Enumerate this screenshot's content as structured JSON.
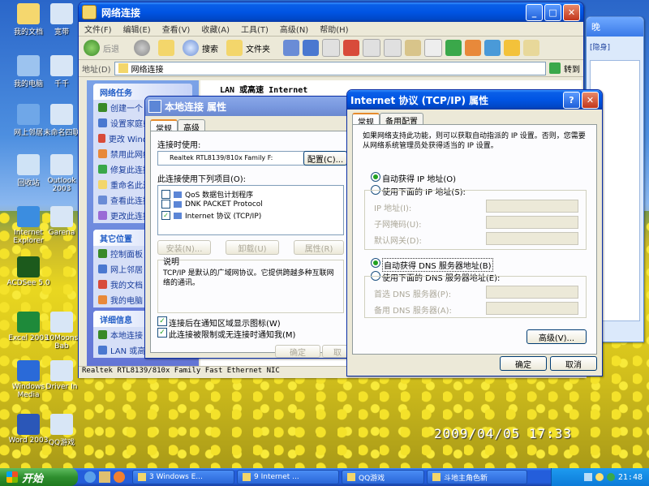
{
  "desktop": {
    "icons": [
      {
        "label": "我的文档",
        "color": "#f5d76e"
      },
      {
        "label": "我的电脑",
        "color": "#9cc3ef"
      },
      {
        "label": "网上邻居",
        "color": "#6fa7e8"
      },
      {
        "label": "回收站",
        "color": "#cfe3f6"
      },
      {
        "label": "Internet Explorer",
        "color": "#3b8de0"
      },
      {
        "label": "ACDSee 5.0",
        "color": "#1c5a1c"
      },
      {
        "label": "Excel 2003",
        "color": "#1e8a3a"
      },
      {
        "label": "Windows Media",
        "color": "#2a6ad8"
      },
      {
        "label": "Word 2003",
        "color": "#2b57b8"
      }
    ],
    "icons_col2": [
      {
        "label": "宽带"
      },
      {
        "label": "千千"
      },
      {
        "label": "未命名四联"
      },
      {
        "label": "Outlook 2003"
      },
      {
        "label": "Garena"
      },
      {
        "label": "10Moons Bab"
      },
      {
        "label": "Driver In"
      },
      {
        "label": "QQ游戏"
      }
    ],
    "photo_timestamp": "2009/04/05 17:33"
  },
  "explorer": {
    "title": "网络连接",
    "menu": [
      "文件(F)",
      "编辑(E)",
      "查看(V)",
      "收藏(A)",
      "工具(T)",
      "高级(N)",
      "帮助(H)"
    ],
    "toolbar": {
      "back": "后退",
      "search": "搜索",
      "folders": "文件夹"
    },
    "address_label": "地址(D)",
    "address_value": "网络连接",
    "go_label": "转到",
    "list_header": "LAN 或高速 Internet",
    "task_groups": [
      {
        "title": "网络任务",
        "items": [
          "创建一个",
          "设置家庭或小型网络",
          "更改 Windows 防火墙设置",
          "禁用此网络",
          "修复此连接",
          "重命名此连接",
          "查看此连接",
          "更改此连接"
        ]
      },
      {
        "title": "其它位置",
        "items": [
          "控制面板",
          "网上邻居",
          "我的文档",
          "我的电脑"
        ]
      },
      {
        "title": "详细信息",
        "items": [
          "本地连接",
          "LAN 或高速 I"
        ]
      }
    ],
    "status_bar": "Realtek RTL8139/810x Family Fast Ethernet NIC"
  },
  "local_props": {
    "title": "本地连接 属性",
    "tabs": [
      "常规",
      "高级"
    ],
    "connect_using_label": "连接时使用:",
    "adapter": "Realtek RTL8139/810x Family F:",
    "configure": "配置(C)...",
    "items_label": "此连接使用下列项目(O):",
    "items": [
      {
        "checked": false,
        "label": "QoS 数据包计划程序"
      },
      {
        "checked": false,
        "label": "DNK PACKET Protocol"
      },
      {
        "checked": true,
        "label": "Internet 协议 (TCP/IP)"
      }
    ],
    "install": "安装(N)...",
    "uninstall": "卸载(U)",
    "properties": "属性(R)",
    "desc_label": "说明",
    "desc_text": "TCP/IP 是默认的广域网协议。它提供跨越多种互联网络的通讯。",
    "show_icon": "连接后在通知区域显示图标(W)",
    "notify_limited": "此连接被限制或无连接时通知我(M)",
    "ok": "确定",
    "cancel": "取"
  },
  "tcpip": {
    "title": "Internet 协议 (TCP/IP) 属性",
    "tabs": [
      "常规",
      "备用配置"
    ],
    "intro": "如果网络支持此功能，则可以获取自动指派的 IP 设置。否则，您需要从网络系统管理员处获得适当的 IP 设置。",
    "auto_ip": "自动获得 IP 地址(O)",
    "manual_ip": "使用下面的 IP 地址(S):",
    "ip_label": "IP 地址(I):",
    "mask_label": "子网掩码(U):",
    "gateway_label": "默认网关(D):",
    "auto_dns": "自动获得 DNS 服务器地址(B)",
    "manual_dns": "使用下面的 DNS 服务器地址(E):",
    "dns1_label": "首选 DNS 服务器(P):",
    "dns2_label": "备用 DNS 服务器(A):",
    "advanced": "高级(V)...",
    "ok": "确定",
    "cancel": "取消"
  },
  "qq": {
    "title_fragment": "晚",
    "status": "[隐身]"
  },
  "taskbar": {
    "start": "开始",
    "items": [
      "3 Windows E...",
      "9 Internet ...",
      "QQ游戏",
      "斗地主角色新"
    ],
    "clock": "21:48"
  }
}
